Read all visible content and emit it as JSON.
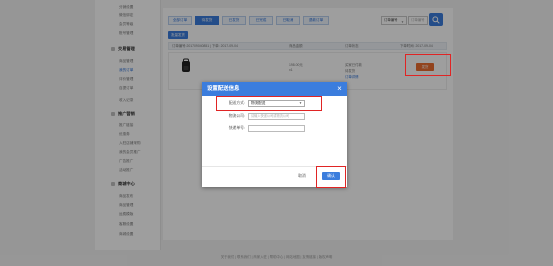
{
  "sidebar": {
    "top_items": [
      "分销设置",
      "微信绑定",
      "会员等级",
      "账号管理"
    ],
    "groups": [
      {
        "label": "交易管理",
        "items": [
          "商品管理",
          "我的订单",
          "评价管理",
          "自提订单",
          "收入记录"
        ]
      },
      {
        "label": "推广营销",
        "items": [
          "推广链接",
          "优惠券",
          "入驻店铺采购",
          "我的会员推广",
          "广告推广",
          "活动推广"
        ]
      },
      {
        "label": "商城中心",
        "items": [
          "商品发布",
          "商品管理",
          "运费模版",
          "客服设置",
          "商城设置"
        ]
      }
    ],
    "active_item": "我的订单"
  },
  "main": {
    "tabs": [
      "全部订单",
      "待发货",
      "已发货",
      "已完成",
      "已取消",
      "退款订单"
    ],
    "active_tab": "待发货",
    "search": {
      "select_value": "订单编号",
      "placeholder": "订单编号"
    },
    "batch_button": "批量发货",
    "table_header": {
      "order_info": "订单编号:201709040851 | 下单: 2017-09-04",
      "amount": "商品金额",
      "status": "订单状态",
      "action": "下单时间: 2017-09-04"
    },
    "order": {
      "price": "198.00元",
      "qty": "x1",
      "pay_state": "买家已付款",
      "status": "待发货",
      "detail": "订单详情",
      "ship_button": "发货"
    }
  },
  "footer": "关于我们 | 联系我们 | 商家入驻 | 帮助中心 | 网站地图 | 友情链接 | 版权声明",
  "modal": {
    "title": "设置配送信息",
    "close": "×",
    "delivery_label": "配送方式:",
    "delivery_value": "物流配送",
    "company_label": "物流公司:",
    "company_placeholder": "请输入快递公司或物流公司",
    "tracking_label": "快递单号:",
    "tracking_value": "",
    "cancel": "取消",
    "confirm": "确认"
  },
  "colors": {
    "primary": "#3b7ddd",
    "ship_button": "#ec6d2f",
    "highlight": "#e02424"
  }
}
